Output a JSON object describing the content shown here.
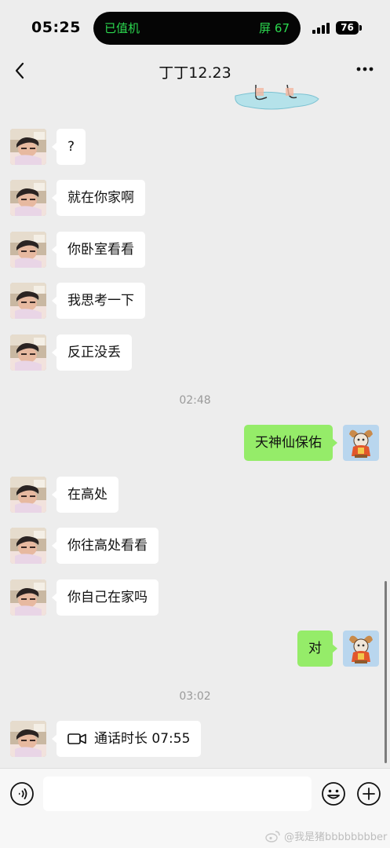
{
  "status_bar": {
    "time": "05:25",
    "island_left": "已值机",
    "island_right": "屏 67",
    "battery": "76"
  },
  "nav": {
    "title": "丁丁12.23"
  },
  "messages": [
    {
      "side": "left",
      "text": "?"
    },
    {
      "side": "left",
      "text": "就在你家啊"
    },
    {
      "side": "left",
      "text": "你卧室看看"
    },
    {
      "side": "left",
      "text": "我思考一下"
    },
    {
      "side": "left",
      "text": "反正没丢"
    },
    {
      "timestamp": "02:48"
    },
    {
      "side": "right",
      "text": "天神仙保佑"
    },
    {
      "side": "left",
      "text": "在高处"
    },
    {
      "side": "left",
      "text": "你往高处看看"
    },
    {
      "side": "left",
      "text": "你自己在家吗"
    },
    {
      "side": "right",
      "text": "对"
    },
    {
      "timestamp": "03:02"
    },
    {
      "side": "left",
      "type": "video-call",
      "text": "通话时长 07:55"
    }
  ],
  "input_bar": {
    "placeholder": ""
  },
  "watermark": "@我是猪bbbbbbbber",
  "colors": {
    "background": "#ededed",
    "sent_bubble": "#95ec69",
    "received_bubble": "#ffffff",
    "island_text": "#2bd94f",
    "timestamp": "#9a9a9a"
  }
}
